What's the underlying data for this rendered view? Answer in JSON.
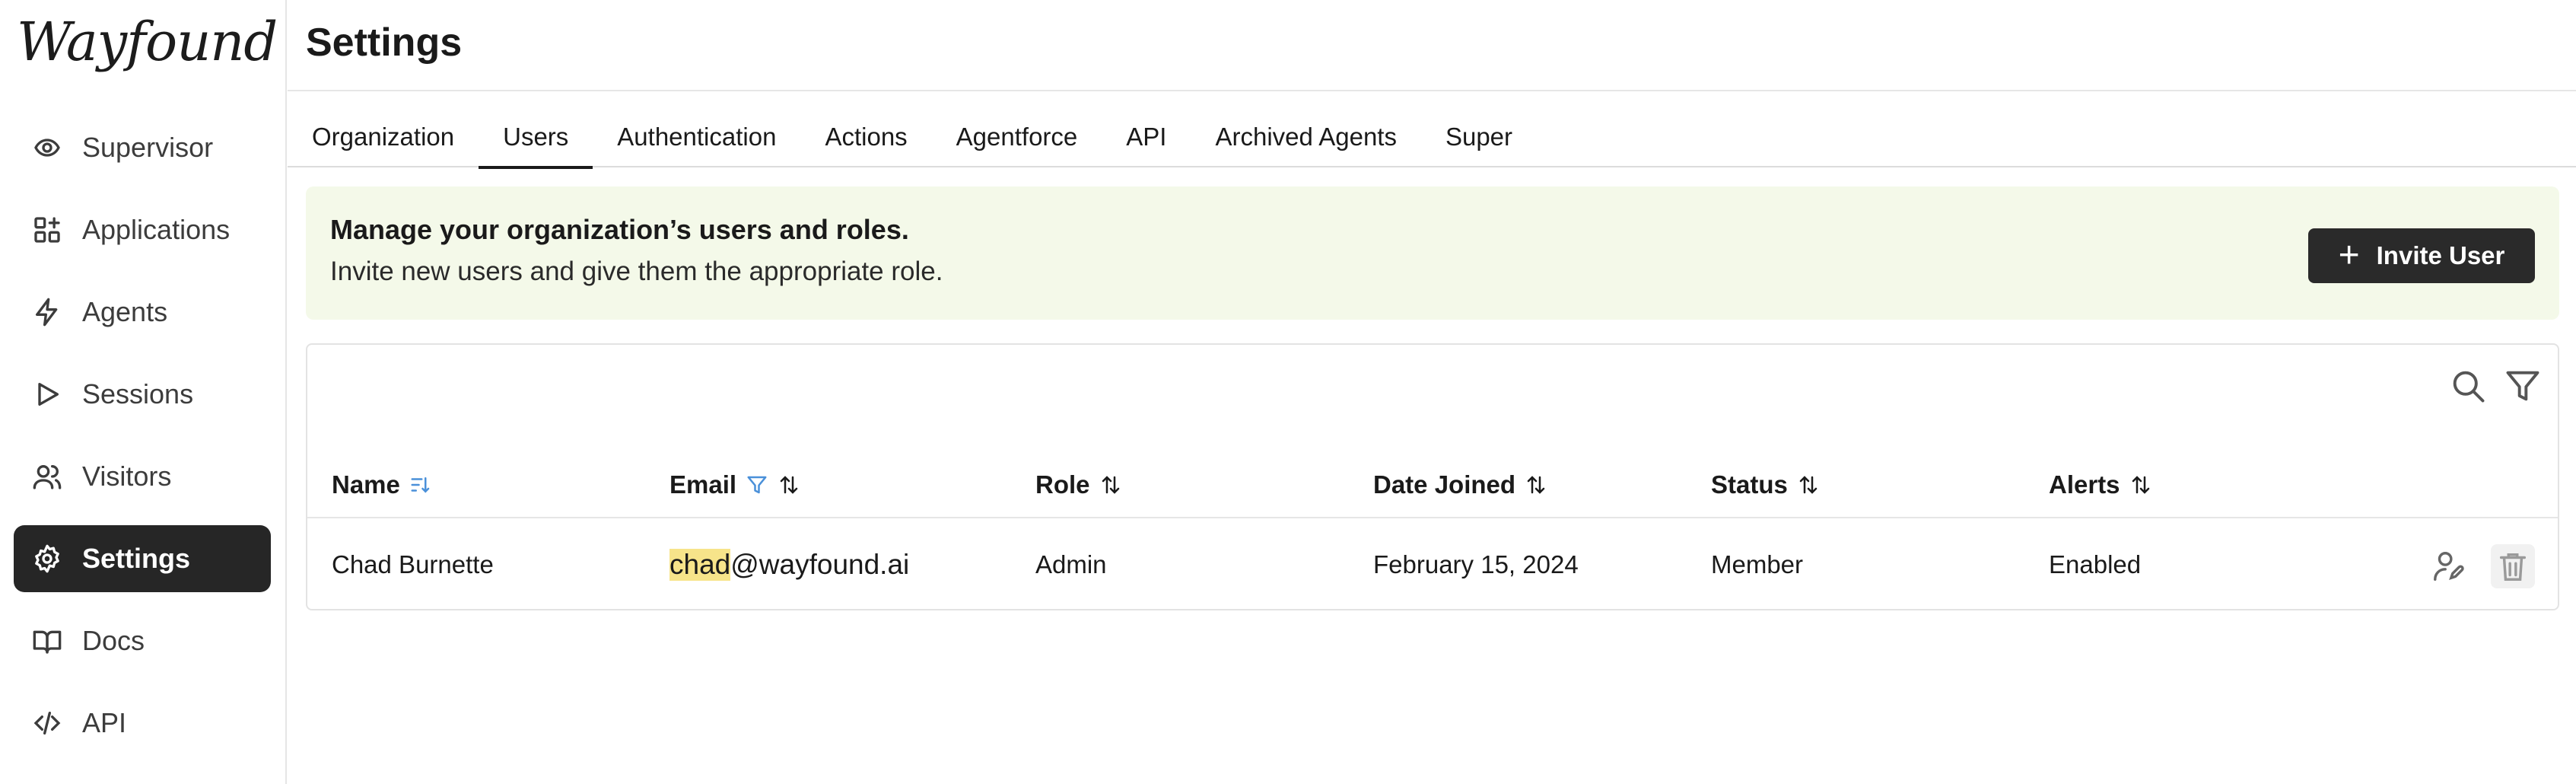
{
  "app": {
    "logo_text": "Wayfound"
  },
  "sidebar": {
    "items": [
      {
        "label": "Supervisor",
        "icon": "eye-target-icon",
        "active": false
      },
      {
        "label": "Applications",
        "icon": "grid-plus-icon",
        "active": false
      },
      {
        "label": "Agents",
        "icon": "lightning-icon",
        "active": false
      },
      {
        "label": "Sessions",
        "icon": "play-icon",
        "active": false
      },
      {
        "label": "Visitors",
        "icon": "users-icon",
        "active": false
      },
      {
        "label": "Settings",
        "icon": "gear-icon",
        "active": true
      },
      {
        "label": "Docs",
        "icon": "book-icon",
        "active": false
      },
      {
        "label": "API",
        "icon": "code-icon",
        "active": false
      }
    ]
  },
  "header": {
    "title": "Settings"
  },
  "tabs": [
    {
      "label": "Organization",
      "active": false
    },
    {
      "label": "Users",
      "active": true
    },
    {
      "label": "Authentication",
      "active": false
    },
    {
      "label": "Actions",
      "active": false
    },
    {
      "label": "Agentforce",
      "active": false
    },
    {
      "label": "API",
      "active": false
    },
    {
      "label": "Archived Agents",
      "active": false
    },
    {
      "label": "Super",
      "active": false
    }
  ],
  "banner": {
    "title": "Manage your organization’s users and roles.",
    "subtitle": "Invite new users and give them the appropriate role.",
    "button_label": "Invite User"
  },
  "table": {
    "columns": [
      {
        "label": "Name",
        "sort": "sorted-desc-icon"
      },
      {
        "label": "Email",
        "sort": "sort-icon",
        "filtered": true
      },
      {
        "label": "Role",
        "sort": "sort-icon"
      },
      {
        "label": "Date Joined",
        "sort": "sort-icon"
      },
      {
        "label": "Status",
        "sort": "sort-icon"
      },
      {
        "label": "Alerts",
        "sort": "sort-icon"
      }
    ],
    "rows": [
      {
        "name": "Chad Burnette",
        "email_highlight": "chad",
        "email_rest": "@wayfound.ai",
        "role": "Admin",
        "date_joined": "February 15, 2024",
        "status": "Member",
        "alerts": "Enabled"
      }
    ]
  },
  "colors": {
    "accent_dark": "#262626",
    "banner_bg": "#f4f9e9",
    "highlight": "#f7e48a",
    "filter_blue": "#4a90d9"
  }
}
